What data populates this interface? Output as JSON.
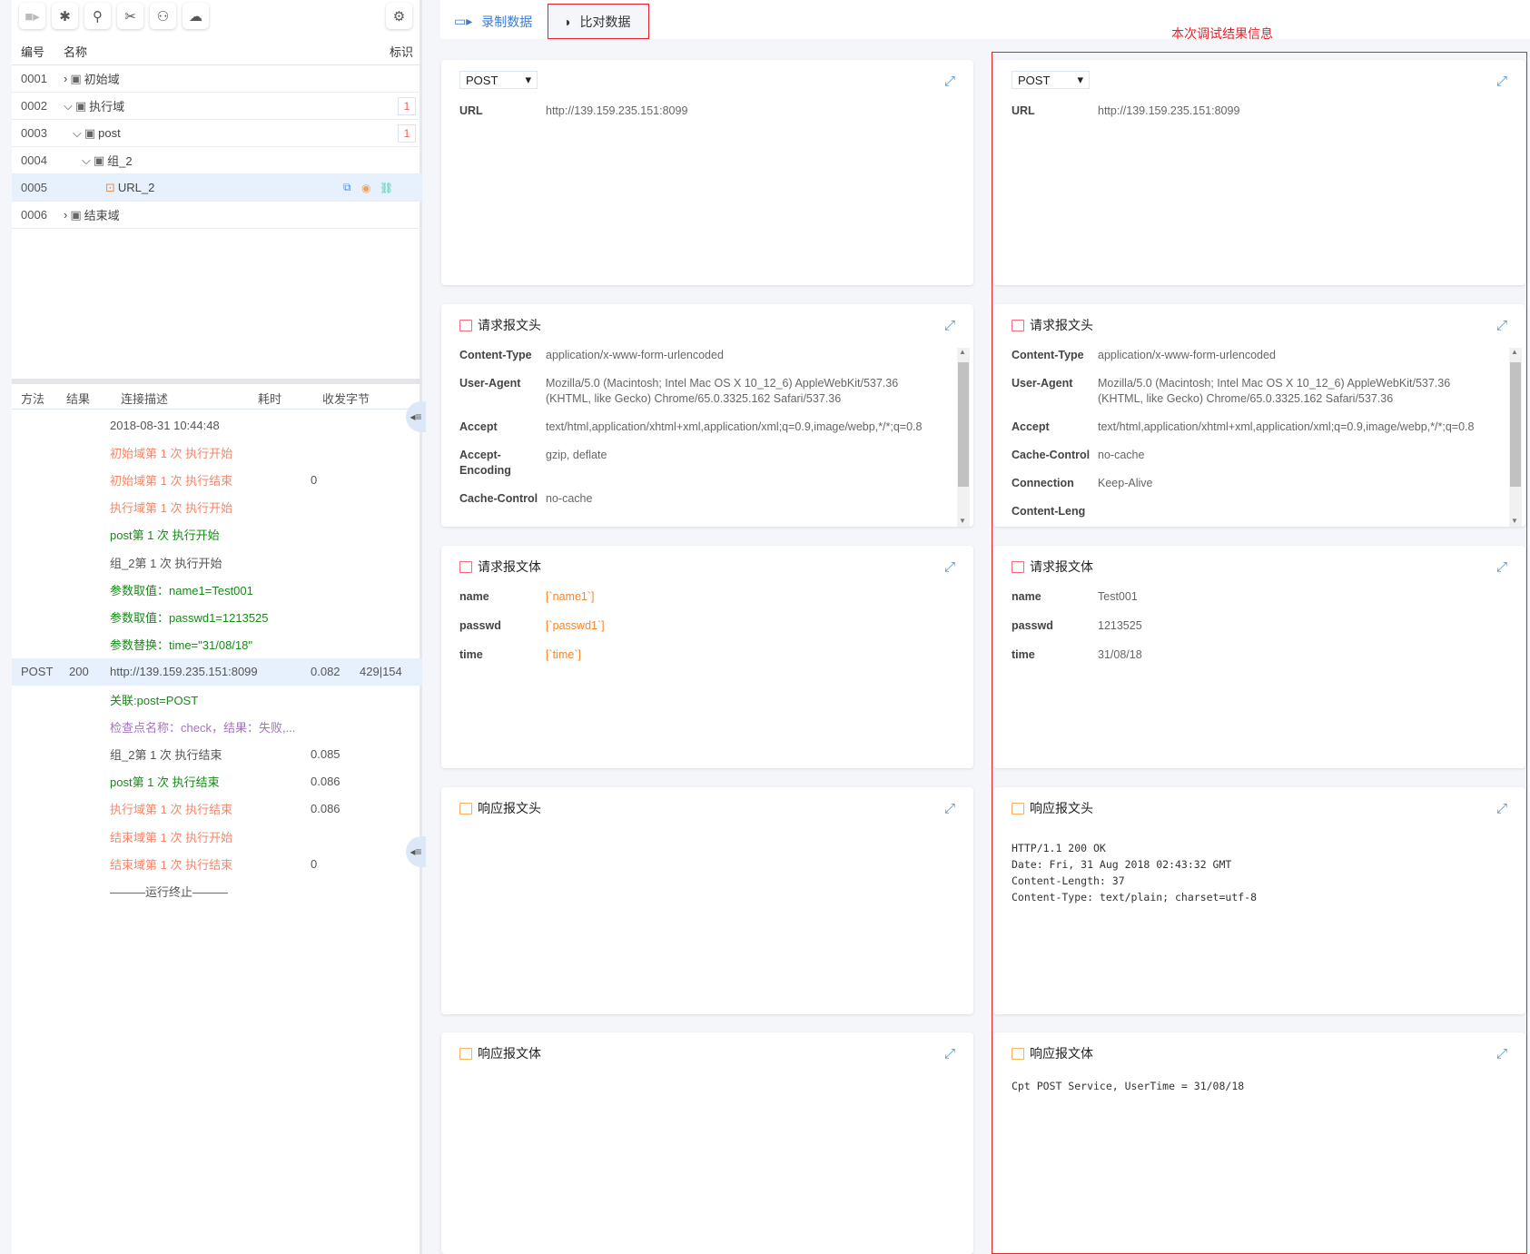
{
  "toolbar": {
    "icons": [
      "video-camera-icon",
      "bug-icon",
      "map-pin-icon",
      "tools-icon",
      "hierarchy-icon",
      "cloud-settings-icon"
    ],
    "settings_icon": "gear-icon"
  },
  "tree": {
    "headers": {
      "id": "编号",
      "name": "名称",
      "flag": "标识"
    },
    "rows": [
      {
        "id": "0001",
        "name": "初始域",
        "level": 0,
        "expanded": false,
        "badge": ""
      },
      {
        "id": "0002",
        "name": "执行域",
        "level": 0,
        "expanded": true,
        "badge": "1"
      },
      {
        "id": "0003",
        "name": "post",
        "level": 1,
        "expanded": true,
        "badge": "1"
      },
      {
        "id": "0004",
        "name": "组_2",
        "level": 2,
        "expanded": true,
        "badge": ""
      },
      {
        "id": "0005",
        "name": "URL_2",
        "level": 3,
        "selected": true,
        "badge": ""
      },
      {
        "id": "0006",
        "name": "结束域",
        "level": 0,
        "expanded": false,
        "badge": ""
      }
    ]
  },
  "log": {
    "headers": {
      "method": "方法",
      "result": "结果",
      "desc": "连接描述",
      "time": "耗时",
      "bytes": "收发字节"
    },
    "rows": [
      {
        "desc": "2018-08-31 10:44:48",
        "color": "#555555"
      },
      {
        "desc": "初始域第 1 次 执行开始",
        "color": "#f5866a"
      },
      {
        "desc": "初始域第 1 次 执行结束",
        "time": "0",
        "color": "#f5866a"
      },
      {
        "desc": "执行域第 1 次 执行开始",
        "color": "#f5866a"
      },
      {
        "desc": "post第 1 次 执行开始",
        "color": "#178a17"
      },
      {
        "desc": "组_2第 1 次 执行开始",
        "color": "#555555"
      },
      {
        "desc": "参数取值：name1=Test001",
        "color": "#178a17"
      },
      {
        "desc": "参数取值：passwd1=1213525",
        "color": "#178a17"
      },
      {
        "desc": "参数替换：time=\"31/08/18\"",
        "color": "#178a17"
      },
      {
        "method": "POST",
        "result": "200",
        "desc": "http://139.159.235.151:8099",
        "time": "0.082",
        "bytes": "429|154",
        "color": "#555555",
        "selected": true
      },
      {
        "desc": "关联:post=POST",
        "color": "#178a17"
      },
      {
        "desc": "检查点名称：check，结果：失败,...",
        "color": "#a672c2"
      },
      {
        "desc": "组_2第 1 次 执行结束",
        "time": "0.085",
        "color": "#555555"
      },
      {
        "desc": "post第 1 次 执行结束",
        "time": "0.086",
        "color": "#178a17"
      },
      {
        "desc": "执行域第 1 次 执行结束",
        "time": "0.086",
        "color": "#f5866a"
      },
      {
        "desc": "结束域第 1 次 执行开始",
        "color": "#f5866a"
      },
      {
        "desc": "结束域第 1 次 执行结束",
        "time": "0",
        "color": "#f5866a"
      },
      {
        "desc": "———运行终止———",
        "color": "#555555"
      }
    ]
  },
  "tabs": [
    {
      "label": "录制数据",
      "icon": "video-camera-icon"
    },
    {
      "label": "比对数据",
      "icon": "compare-icon",
      "active": true
    }
  ],
  "annotation": "本次调试结果信息",
  "accent": "#4a90e2",
  "highlight": "#e8202a",
  "recorded": {
    "method": "POST",
    "url_label": "URL",
    "url": "http://139.159.235.151:8099",
    "req_header_title": "请求报文头",
    "req_headers": [
      {
        "k": "Content-Type",
        "v": "application/x-www-form-urlencoded"
      },
      {
        "k": "User-Agent",
        "v": "Mozilla/5.0 (Macintosh; Intel Mac OS X 10_12_6) AppleWebKit/537.36 (KHTML, like Gecko) Chrome/65.0.3325.162 Safari/537.36"
      },
      {
        "k": "Accept",
        "v": "text/html,application/xhtml+xml,application/xml;q=0.9,image/webp,*/*;q=0.8"
      },
      {
        "k": "Accept-Encoding",
        "v": "gzip, deflate"
      },
      {
        "k": "Cache-Control",
        "v": "no-cache"
      }
    ],
    "req_body_title": "请求报文体",
    "req_body": [
      {
        "k": "name",
        "v": "[`name1`]"
      },
      {
        "k": "passwd",
        "v": "[`passwd1`]"
      },
      {
        "k": "time",
        "v": "[`time`]"
      }
    ],
    "resp_header_title": "响应报文头",
    "resp_header": "",
    "resp_body_title": "响应报文体",
    "resp_body": ""
  },
  "debug": {
    "method": "POST",
    "url_label": "URL",
    "url": "http://139.159.235.151:8099",
    "req_header_title": "请求报文头",
    "req_headers": [
      {
        "k": "Content-Type",
        "v": "application/x-www-form-urlencoded"
      },
      {
        "k": "User-Agent",
        "v": "Mozilla/5.0 (Macintosh; Intel Mac OS X 10_12_6) AppleWebKit/537.36 (KHTML, like Gecko) Chrome/65.0.3325.162 Safari/537.36"
      },
      {
        "k": "Accept",
        "v": "text/html,application/xhtml+xml,application/xml;q=0.9,image/webp,*/*;q=0.8"
      },
      {
        "k": "Cache-Control",
        "v": "no-cache"
      },
      {
        "k": "Connection",
        "v": "Keep-Alive"
      },
      {
        "k": "Content-Leng",
        "v": ""
      }
    ],
    "req_body_title": "请求报文体",
    "req_body": [
      {
        "k": "name",
        "v": "Test001"
      },
      {
        "k": "passwd",
        "v": "1213525"
      },
      {
        "k": "time",
        "v": "31/08/18"
      }
    ],
    "resp_header_title": "响应报文头",
    "resp_header": "HTTP/1.1 200 OK\nDate: Fri, 31 Aug 2018 02:43:32 GMT\nContent-Length: 37\nContent-Type: text/plain; charset=utf-8",
    "resp_body_title": "响应报文体",
    "resp_body": "Cpt POST Service, UserTime = 31/08/18"
  }
}
